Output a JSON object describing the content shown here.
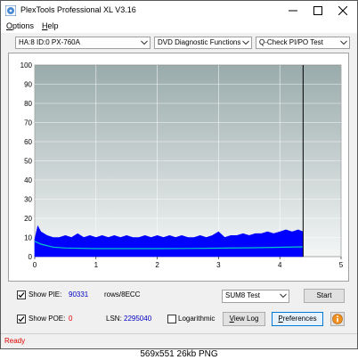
{
  "window": {
    "title": "PlexTools Professional XL V3.16",
    "controls": {
      "minimize_icon": "minimize-icon",
      "maximize_icon": "maximize-icon",
      "close_icon": "close-icon"
    }
  },
  "menu": {
    "options": {
      "mnemonic": "O",
      "rest": "ptions"
    },
    "help": {
      "mnemonic": "H",
      "rest": "elp"
    }
  },
  "toolbar": {
    "drive": "HA:8 ID:0  PX-760A",
    "function": "DVD Diagnostic Functions",
    "test": "Q-Check PI/PO Test"
  },
  "chart_data": {
    "type": "area",
    "title": "",
    "xlabel": "",
    "ylabel": "",
    "xlim": [
      0,
      5
    ],
    "ylim": [
      0,
      100
    ],
    "x_ticks": [
      "0",
      "1",
      "2",
      "3",
      "4",
      "5"
    ],
    "y_ticks": [
      "0",
      "10",
      "20",
      "30",
      "40",
      "50",
      "60",
      "70",
      "80",
      "90",
      "100"
    ],
    "grid": true,
    "scan_end": 4.38,
    "series": [
      {
        "kind": "pi-errors",
        "color": "#0000ff",
        "x": [
          0.0,
          0.05,
          0.1,
          0.2,
          0.3,
          0.4,
          0.5,
          0.6,
          0.7,
          0.8,
          0.9,
          1.0,
          1.1,
          1.2,
          1.3,
          1.4,
          1.5,
          1.6,
          1.7,
          1.8,
          1.9,
          2.0,
          2.1,
          2.2,
          2.3,
          2.4,
          2.5,
          2.6,
          2.7,
          2.8,
          2.9,
          3.0,
          3.1,
          3.2,
          3.3,
          3.4,
          3.5,
          3.6,
          3.7,
          3.8,
          3.9,
          4.0,
          4.1,
          4.2,
          4.3,
          4.38
        ],
        "y": [
          9,
          16,
          13,
          11,
          10,
          10,
          11,
          10,
          12,
          10,
          11,
          10,
          11,
          10,
          11,
          10,
          11,
          10,
          10,
          11,
          10,
          11,
          10,
          11,
          10,
          11,
          10,
          10,
          11,
          10,
          11,
          13,
          10,
          11,
          11,
          12,
          11,
          12,
          12,
          13,
          12,
          13,
          14,
          13,
          14,
          13
        ]
      },
      {
        "kind": "pi-average",
        "color": "#00c8c8",
        "x": [
          0.0,
          0.1,
          0.3,
          0.5,
          1.0,
          1.5,
          2.0,
          2.5,
          3.0,
          3.5,
          4.0,
          4.38
        ],
        "y": [
          8,
          6.5,
          5,
          4.5,
          4.2,
          4.2,
          4.2,
          4.3,
          4.4,
          4.6,
          4.9,
          5.1
        ]
      }
    ]
  },
  "stats": {
    "show_pie_label": "Show PIE:",
    "pie_value": "90331",
    "pie_unit": "rows/8ECC",
    "show_poe_label": "Show POE:",
    "poe_value": "0",
    "lsn_label": "LSN:",
    "lsn_value": "2295040",
    "logarithmic_label": "Logarithmic",
    "show_pie_checked": true,
    "show_poe_checked": true,
    "logarithmic_checked": false
  },
  "controls": {
    "test_mode": "SUM8 Test",
    "start_label": "Start",
    "view_log": {
      "mnemonic": "V",
      "rest": "iew Log"
    },
    "preferences": {
      "mnemonic": "P",
      "rest": "references"
    },
    "help_icon": "info-icon"
  },
  "status": {
    "text": "Ready"
  },
  "caption": "569x551  26kb  PNG",
  "colors": {
    "accent": "#0078d7",
    "pie_value": "#0000c0",
    "poe_value": "#e00000",
    "status": "#e00000",
    "error_bars": "#0000ff",
    "average_line": "#00c8c8"
  }
}
